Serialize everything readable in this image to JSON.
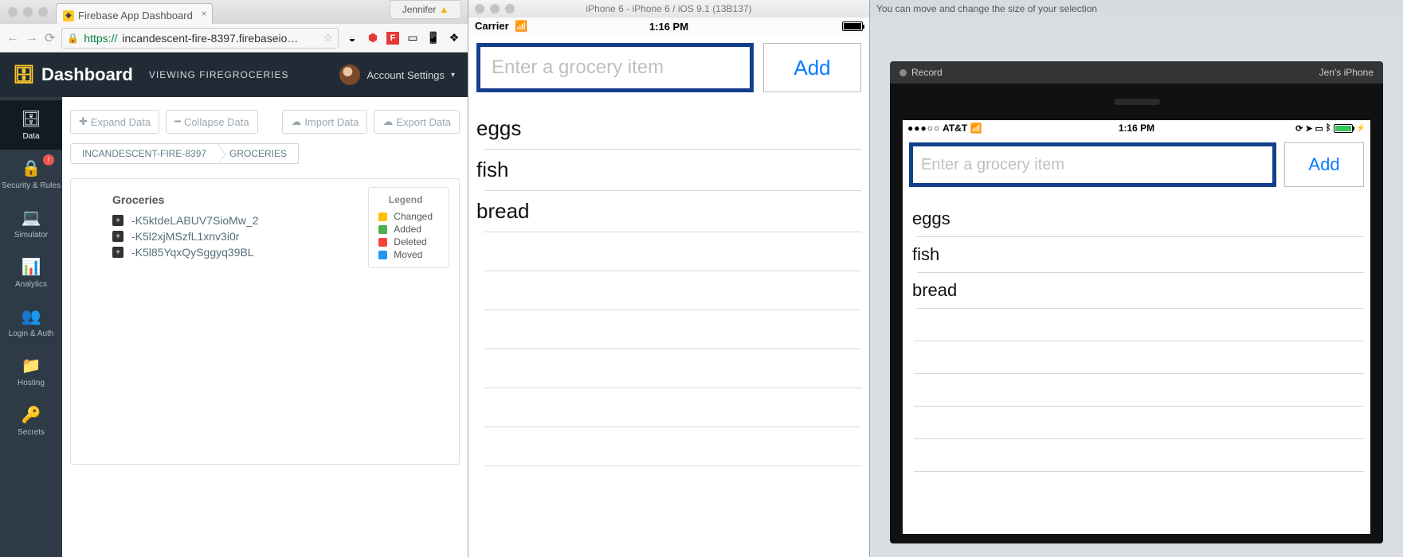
{
  "browser": {
    "profile_name": "Jennifer",
    "tab": {
      "title": "Firebase App Dashboard"
    },
    "url_prefix": "https://",
    "url_rest": "incandescent-fire-8397.firebaseio…"
  },
  "firebase": {
    "logo": "Dashboard",
    "viewing_label": "VIEWING FIREGROCERIES",
    "account_label": "Account Settings",
    "side": [
      {
        "label": "Data"
      },
      {
        "label": "Security & Rules"
      },
      {
        "label": "Simulator"
      },
      {
        "label": "Analytics"
      },
      {
        "label": "Login & Auth"
      },
      {
        "label": "Hosting"
      },
      {
        "label": "Secrets"
      }
    ],
    "buttons": {
      "expand": "Expand Data",
      "collapse": "Collapse Data",
      "import": "Import Data",
      "export": "Export Data"
    },
    "crumbs": [
      "INCANDESCENT-FIRE-8397",
      "GROCERIES"
    ],
    "tree_root": "Groceries",
    "tree": [
      "-K5ktdeLABUV7SioMw_2",
      "-K5l2xjMSzfL1xnv3i0r",
      "-K5l85YqxQySggyq39BL"
    ],
    "legend": {
      "title": "Legend",
      "items": [
        {
          "label": "Changed",
          "color": "#ffc107"
        },
        {
          "label": "Added",
          "color": "#4caf50"
        },
        {
          "label": "Deleted",
          "color": "#f44336"
        },
        {
          "label": "Moved",
          "color": "#2196f3"
        }
      ]
    }
  },
  "simulator": {
    "window_title": "iPhone 6 - iPhone 6 / iOS 9.1 (13B137)",
    "carrier": "Carrier",
    "time": "1:16 PM",
    "placeholder": "Enter a grocery item",
    "add": "Add",
    "items": [
      "eggs",
      "fish",
      "bread"
    ]
  },
  "quicktime": {
    "hint": "You can move and change the size of your selection",
    "record": "Record",
    "device": "Jen's iPhone",
    "carrier": "AT&T",
    "signal": "●●●○○",
    "time": "1:16 PM",
    "placeholder": "Enter a grocery item",
    "add": "Add",
    "items": [
      "eggs",
      "fish",
      "bread"
    ]
  }
}
